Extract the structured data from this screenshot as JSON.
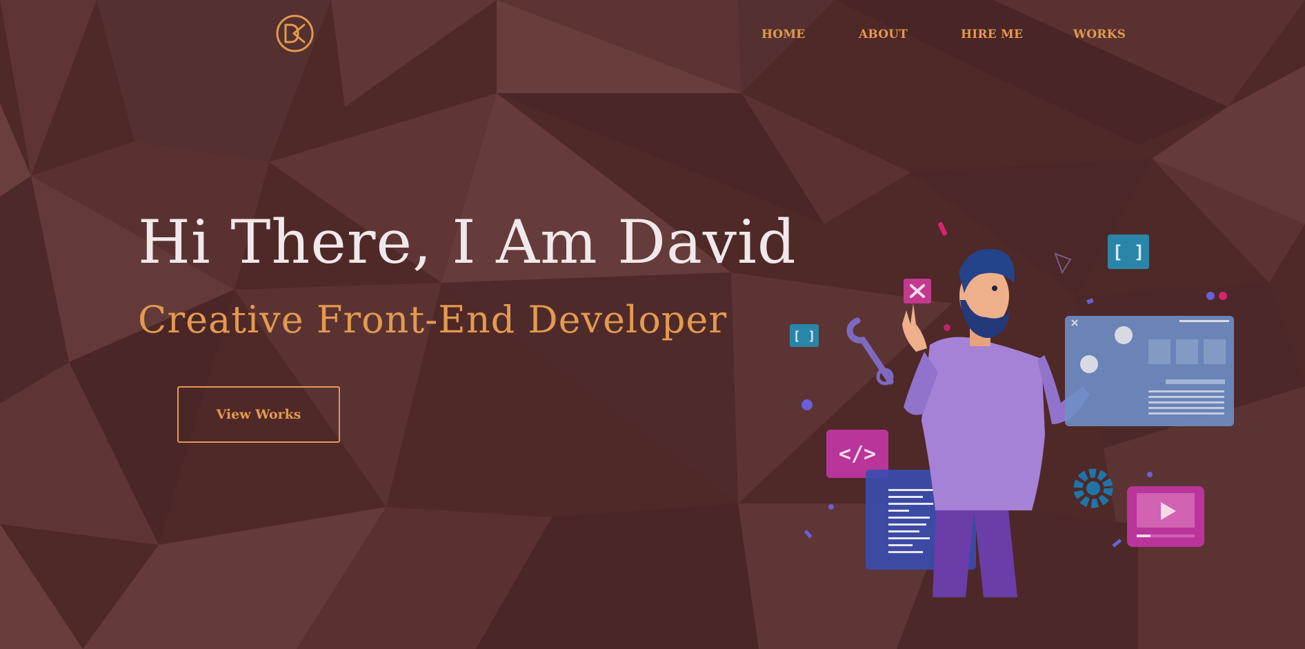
{
  "brand": {
    "logo_text": "DK"
  },
  "nav": {
    "items": [
      {
        "label": "HOME"
      },
      {
        "label": "ABOUT"
      },
      {
        "label": "HIRE ME"
      },
      {
        "label": "WORKS"
      }
    ]
  },
  "hero": {
    "title": "Hi There, I Am David",
    "subtitle": "Creative Front-End Developer",
    "cta_label": "View Works"
  },
  "illustration": {
    "icons": [
      "close-icon",
      "brackets-icon",
      "code-icon",
      "wrench-icon",
      "gear-icon",
      "play-icon",
      "document-icon",
      "browser-window-icon"
    ]
  },
  "colors": {
    "background": "#4f2929",
    "accent": "#e39a4f",
    "headline": "#f1e9e9"
  }
}
